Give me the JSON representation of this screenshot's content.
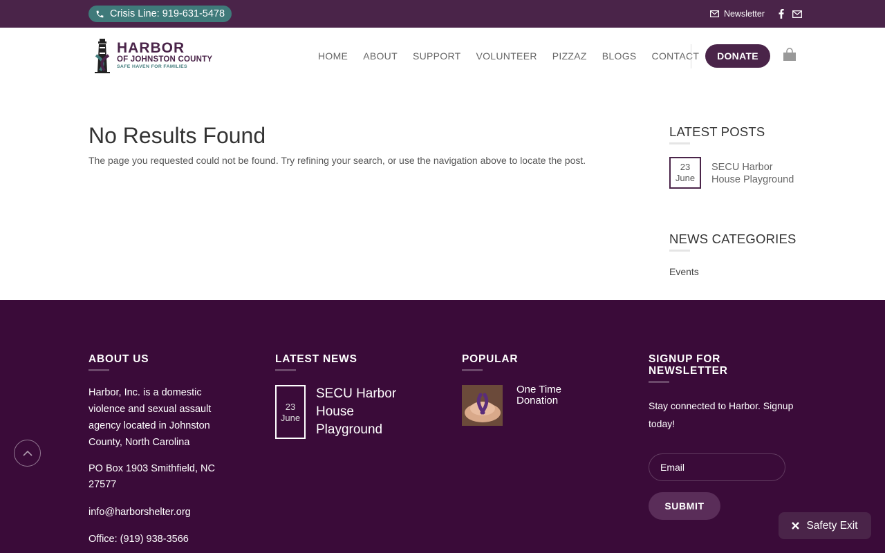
{
  "topbar": {
    "crisis_line": "Crisis Line: 919-631-5478",
    "newsletter_label": "Newsletter"
  },
  "logo": {
    "line1": "HARBOR",
    "line2": "OF JOHNSTON COUNTY",
    "line3": "SAFE HAVEN FOR FAMILIES"
  },
  "nav": {
    "items": [
      "HOME",
      "ABOUT",
      "SUPPORT",
      "VOLUNTEER",
      "PIZZAZ",
      "BLOGS",
      "CONTACT"
    ],
    "donate_label": "DONATE"
  },
  "main": {
    "title": "No Results Found",
    "text": "The page you requested could not be found. Try refining your search, or use the navigation above to locate the post."
  },
  "sidebar": {
    "latest_posts_heading": "LATEST POSTS",
    "post": {
      "day": "23",
      "month": "June",
      "title": "SECU Harbor House Playground"
    },
    "categories_heading": "NEWS CATEGORIES",
    "category": "Events"
  },
  "footer": {
    "about_heading": "ABOUT US",
    "about_text": "Harbor, Inc. is a domestic violence and sexual assault agency located in Johnston County, North Carolina",
    "address": "PO Box 1903 Smithfield, NC 27577",
    "email": "info@harborshelter.org",
    "office": "Office: (919) 938-3566",
    "news_heading": "LATEST NEWS",
    "news_post": {
      "day": "23",
      "month": "June",
      "title": "SECU Harbor House Playground"
    },
    "popular_heading": "POPULAR",
    "popular_item": "One Time Donation",
    "signup_heading": "SIGNUP FOR NEWSLETTER",
    "signup_text": "Stay connected to Harbor. Signup today!",
    "email_placeholder": "Email",
    "submit_label": "SUBMIT"
  },
  "safety_exit": "Safety Exit",
  "colors": {
    "brand_purple": "#4a2449",
    "footer_bg": "#3a0b39",
    "teal": "#3f7a7a"
  }
}
